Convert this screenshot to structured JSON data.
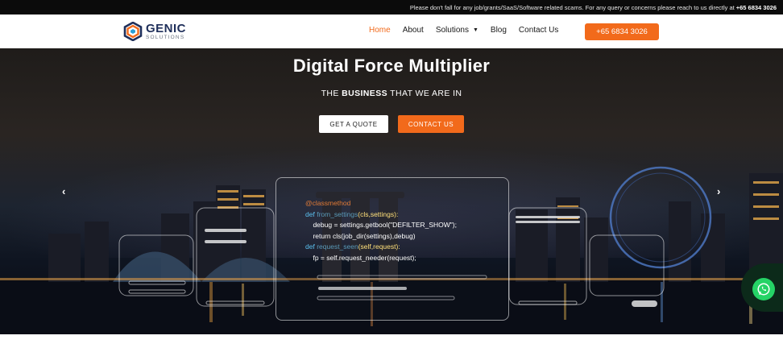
{
  "announcement": {
    "text": "Please don't fall for any job/grants/SaaS/Software related scams. For any query or concerns please reach to us directly at",
    "phone": "+65 6834 3026"
  },
  "brand": {
    "name": "GENIC",
    "tagline": "SOLUTIONS",
    "accent": "#f26a1b",
    "navy": "#1f2f5a"
  },
  "nav": {
    "items": [
      {
        "label": "Home"
      },
      {
        "label": "About"
      },
      {
        "label": "Solutions"
      },
      {
        "label": "Blog"
      },
      {
        "label": "Contact Us"
      }
    ],
    "phone_button": "+65 6834 3026"
  },
  "hero": {
    "title": "Digital Force Multiplier",
    "subtitle_pre": "THE",
    "subtitle_bold": "BUSINESS",
    "subtitle_post": "THAT WE ARE IN",
    "quote_button": "GET A QUOTE",
    "contact_button": "CONTACT US",
    "prev_arrow": "‹",
    "next_arrow": "›"
  },
  "code": {
    "line1": "@classmethod",
    "line2_kw": "def",
    "line2_fn": "from_settings",
    "line2_arg": "(cls,settings):",
    "line3": "debug = settings.getbool(\"DEFILTER_SHOW\");",
    "line4": "return cls(job_dir(settings),debug)",
    "line5_kw": "def",
    "line5_fn": "request_seen",
    "line5_arg": "(self,request):",
    "line6": "fp = self.request_needer(request);"
  },
  "icons": {
    "whatsapp": "whatsapp-icon",
    "logo": "genic-hexagon-logo"
  }
}
